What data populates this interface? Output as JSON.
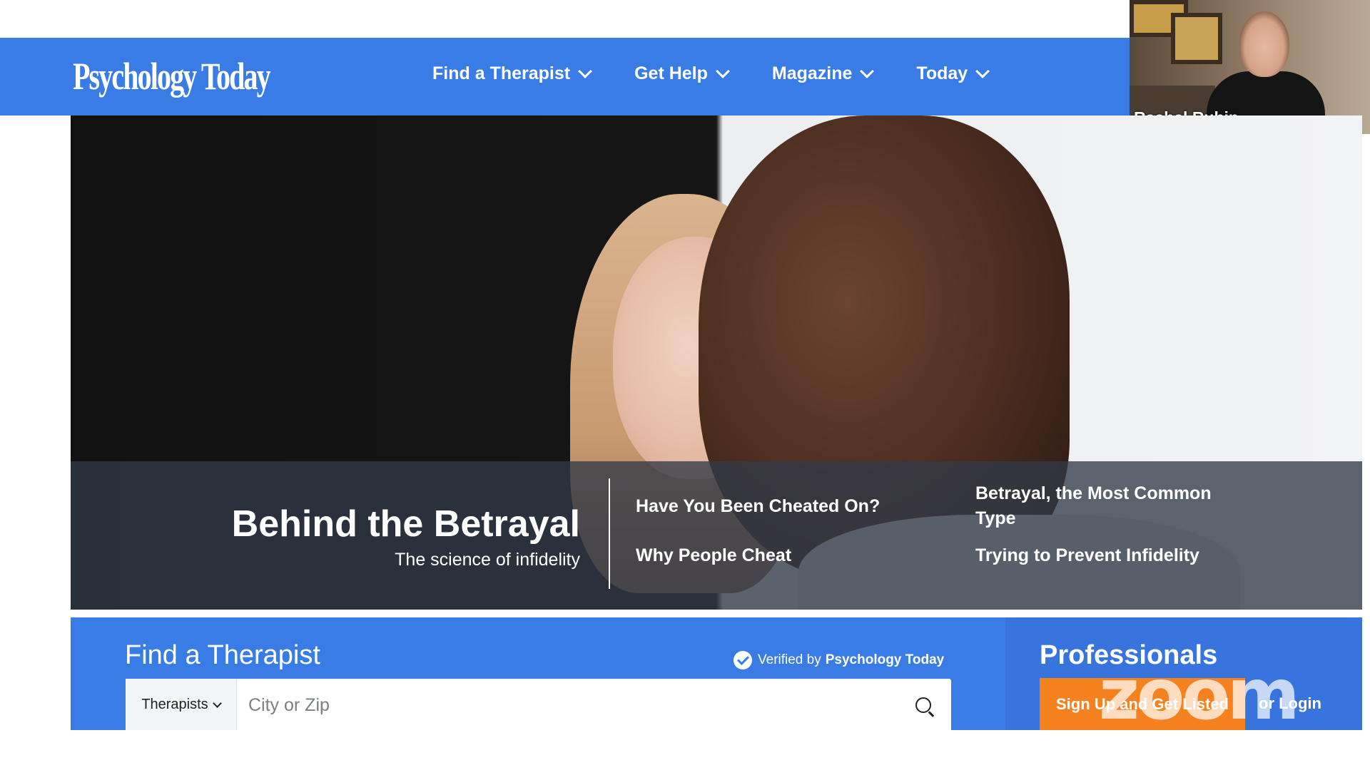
{
  "header": {
    "logo_text": "Psychology Today",
    "nav": [
      {
        "label": "Find a Therapist"
      },
      {
        "label": "Get Help"
      },
      {
        "label": "Magazine"
      },
      {
        "label": "Today"
      }
    ]
  },
  "video": {
    "participant_name": "Rachel Rubin"
  },
  "hero": {
    "title": "Behind the Betrayal",
    "subtitle": "The science of infidelity",
    "links": [
      "Have You Been Cheated On?",
      "Why People Cheat",
      "Betrayal, the Most Common Type",
      "Trying to Prevent Infidelity"
    ]
  },
  "find": {
    "title": "Find a Therapist",
    "verified_prefix": "Verified by",
    "verified_brand": "Psychology Today",
    "select_value": "Therapists",
    "search_placeholder": "City or Zip"
  },
  "professionals": {
    "title": "Professionals",
    "signup_label": "Sign Up and Get Listed",
    "login_label": "or Login"
  },
  "watermark": "zoom",
  "colors": {
    "brand_blue": "#3a7ce6",
    "cta_orange": "#f6821f"
  },
  "icons": [
    "chevron-down-icon",
    "check-circle-icon",
    "search-icon"
  ]
}
